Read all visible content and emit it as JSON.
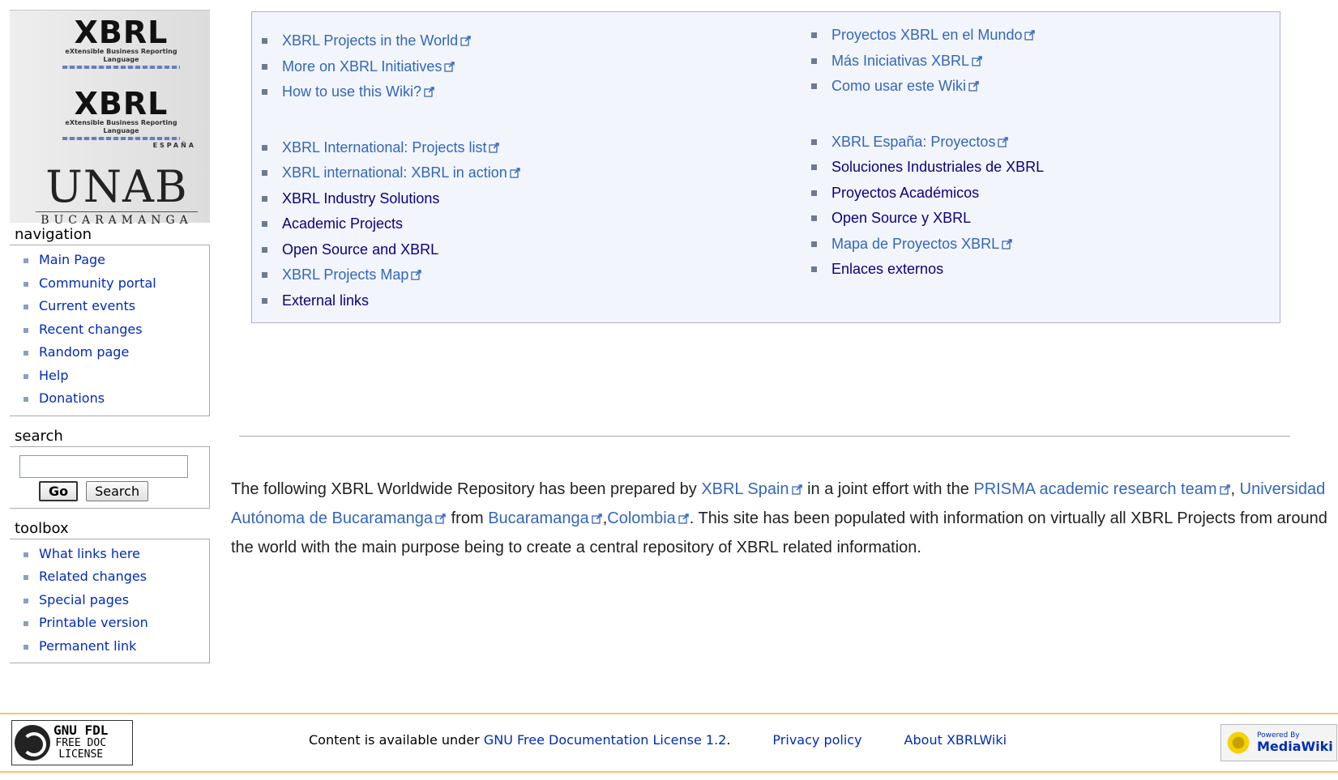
{
  "logo": {
    "xbrl_top": "XBRL",
    "xbrl_top_sub": "eXtensible Business Reporting Language",
    "xbrl_es": "XBRL",
    "xbrl_es_sub": "eXtensible Business Reporting Language",
    "xbrl_es_tag": "ESPAÑA",
    "unab": "UNAB",
    "unab_sub": "BUCARAMANGA"
  },
  "navigation": {
    "title": "navigation",
    "items": [
      "Main Page",
      "Community portal",
      "Current events",
      "Recent changes",
      "Random page",
      "Help",
      "Donations"
    ]
  },
  "search": {
    "title": "search",
    "value": "",
    "go_label": "Go",
    "search_label": "Search"
  },
  "toolbox": {
    "title": "toolbox",
    "items": [
      "What links here",
      "Related changes",
      "Special pages",
      "Printable version",
      "Permanent link"
    ]
  },
  "projects_en": {
    "group1": [
      "XBRL Projects in the World",
      "More on XBRL Initiatives",
      "How to use this Wiki?"
    ],
    "group2": [
      {
        "label": "XBRL International: Projects list",
        "external": true
      },
      {
        "label": "XBRL international: XBRL in action",
        "external": true
      },
      {
        "label": "XBRL Industry Solutions",
        "external": false
      },
      {
        "label": "Academic Projects",
        "external": false
      },
      {
        "label": "Open Source and XBRL",
        "external": false
      },
      {
        "label": "XBRL Projects Map",
        "external": true
      },
      {
        "label": "External links",
        "external": false
      }
    ]
  },
  "projects_es": {
    "group1": [
      "Proyectos XBRL en el Mundo",
      "Más Iniciativas XBRL",
      "Como usar este Wiki"
    ],
    "group2": [
      {
        "label": "XBRL España: Proyectos",
        "external": true
      },
      {
        "label": "Soluciones Industriales de XBRL",
        "external": false
      },
      {
        "label": "Proyectos Académicos",
        "external": false
      },
      {
        "label": "Open Source y XBRL",
        "external": false
      },
      {
        "label": "Mapa de Proyectos XBRL",
        "external": true
      },
      {
        "label": "Enlaces externos",
        "external": false
      }
    ]
  },
  "intro": {
    "t1": "The following XBRL Worldwide Repository has been prepared by ",
    "l1": "XBRL Spain",
    "t2": " in a joint effort with the ",
    "l2": "PRISMA academic research team",
    "t3": ", ",
    "l3": "Universidad Autónoma de Bucaramanga",
    "t4": " from ",
    "l4": "Bucaramanga",
    "t5": ",",
    "l5": "Colombia",
    "t6": ".  This site has been populated with information on virtually all XBRL Projects from around the world with the main purpose being to create a central repository of XBRL related information."
  },
  "footer": {
    "gnu_title": "GNU FDL",
    "gnu_line2": "FREE DOC",
    "gnu_line3": "LICENSE",
    "license_prefix": "Content is available under ",
    "license_link": "GNU Free Documentation License 1.2",
    "license_suffix": ".",
    "privacy": "Privacy policy",
    "about": "About XBRLWiki",
    "mw_powered": "Powered By",
    "mw_name": "MediaWiki"
  }
}
